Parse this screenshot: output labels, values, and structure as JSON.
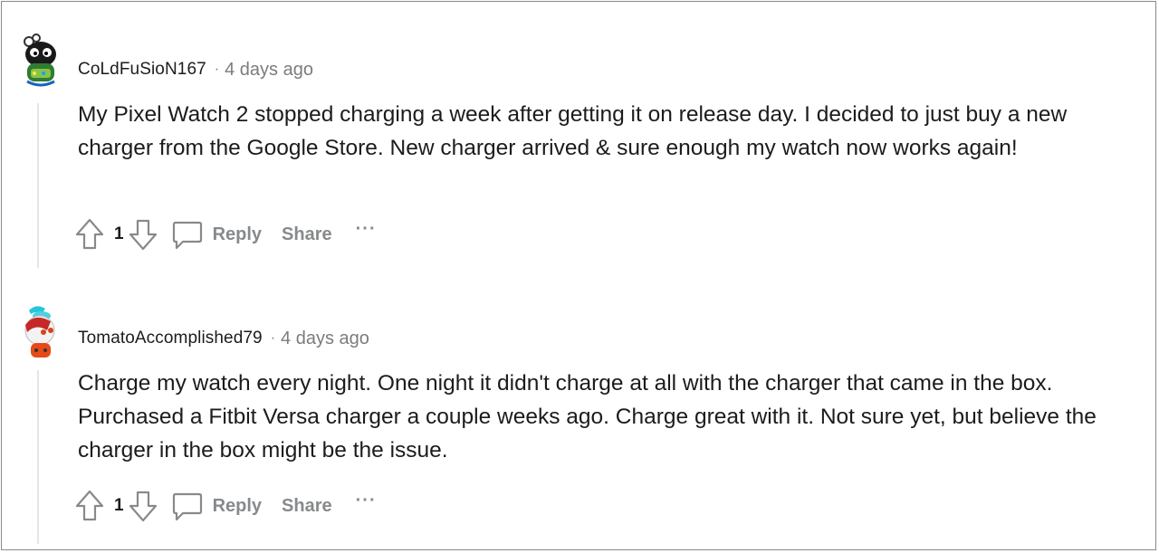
{
  "comments": [
    {
      "username": "CoLdFuSioN167",
      "separator": "·",
      "time": "4 days ago",
      "text": "My Pixel Watch 2 stopped charging a week after getting it on release day. I decided to just buy a new charger from the Google Store. New charger arrived & sure enough my watch now works again!",
      "votes": "1",
      "reply_label": "Reply",
      "share_label": "Share",
      "more_label": "···"
    },
    {
      "username": "TomatoAccomplished79",
      "separator": "·",
      "time": "4 days ago",
      "text": "Charge my watch every night. One night it didn't charge at all with the charger that came in the box. Purchased a Fitbit Versa charger a couple weeks ago. Charge great with it. Not sure yet, but believe the charger in the box might be the issue.",
      "votes": "1",
      "reply_label": "Reply",
      "share_label": "Share",
      "more_label": "···"
    }
  ]
}
